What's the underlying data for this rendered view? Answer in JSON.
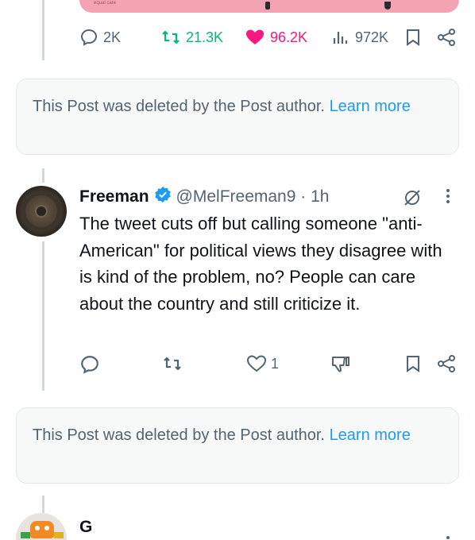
{
  "top_tweet": {
    "media_caption": "equal care",
    "metrics": {
      "replies": "2K",
      "reposts": "21.3K",
      "likes": "96.2K",
      "views": "972K"
    }
  },
  "deleted_notice_1": {
    "text": "This Post was deleted by the Post author.",
    "link": "Learn more"
  },
  "reply_tweet": {
    "display_name": "Freeman",
    "handle_time": "@MelFreeman9 · 1h",
    "text": "The tweet cuts off but calling someone \"anti-American\" for political views they disagree with is kind of the problem, no? People can care about the country and still criticize it.",
    "likes": "1"
  },
  "deleted_notice_2": {
    "text": "This Post was deleted by the Post author.",
    "link": "Learn more"
  },
  "next_tweet": {
    "display_name": "G"
  },
  "colors": {
    "accent": "#1d9bf0",
    "retweet_green": "#00ba7c",
    "like_pink": "#f91880",
    "secondary_text": "#536471"
  }
}
